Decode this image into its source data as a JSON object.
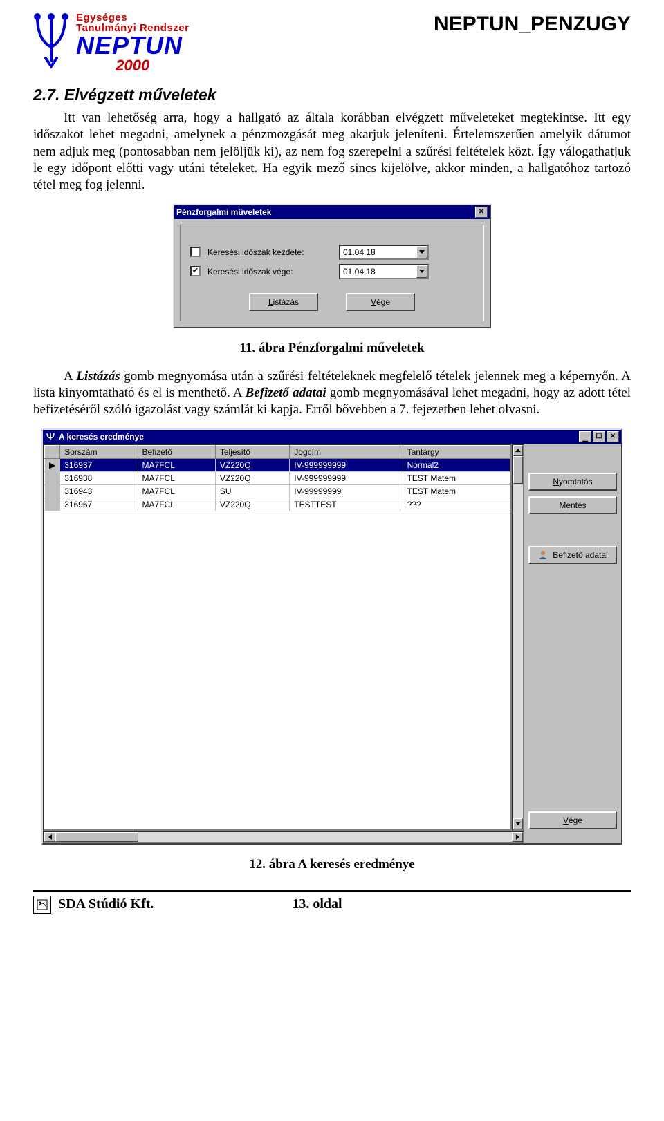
{
  "header": {
    "logo_line1": "Egységes",
    "logo_line2": "Tanulmányi  Rendszer",
    "logo_brand": "NEPTUN",
    "logo_year": "2000",
    "page_title": "NEPTUN_PENZUGY"
  },
  "section": {
    "heading": "2.7. Elvégzett műveletek",
    "para1": "Itt van lehetőség arra, hogy a hallgató az általa korábban elvégzett műveleteket megtekintse. Itt egy időszakot lehet megadni, amelynek a pénzmozgását meg akarjuk jeleníteni. Értelemszerűen amelyik dátumot nem adjuk meg (pontosabban nem jelöljük ki), az nem fog szerepelni a szűrési feltételek közt. Így válogathatjuk le egy időpont előtti vagy utáni tételeket. Ha egyik mező sincs kijelölve, akkor minden, a hallgatóhoz tartozó tétel meg fog jelenni.",
    "caption1": "11. ábra Pénzforgalmi műveletek",
    "para2_pre": "A ",
    "para2_bold1": "Listázás",
    "para2_mid1": " gomb megnyomása után a szűrési feltételeknek megfelelő tételek jelennek meg a képernyőn. A lista kinyomtatható és el is menthető. A ",
    "para2_bold2": "Befizető adatai",
    "para2_mid2": " gomb megnyomásával lehet megadni, hogy az adott tétel befizetéséről szóló igazolást vagy számlát ki kapja. Erről bővebben a 7. fejezetben lehet olvasni.",
    "caption2": "12. ábra A keresés eredménye"
  },
  "dialog1": {
    "title": "Pénzforgalmi műveletek",
    "row1_label": "Keresési időszak kezdete:",
    "row1_checked": false,
    "row1_value": "01.04.18",
    "row2_label": "Keresési időszak vége:",
    "row2_checked": true,
    "row2_value": "01.04.18",
    "btn_list": "Listázás",
    "btn_list_ul": "L",
    "btn_end": "Vége",
    "btn_end_ul": "V"
  },
  "dialog2": {
    "title": "A keresés eredménye",
    "columns": [
      "Sorszám",
      "Befizető",
      "Teljesítő",
      "Jogcím",
      "Tantárgy"
    ],
    "rows": [
      {
        "mark": "▶",
        "sel": true,
        "c": [
          "316937",
          "MA7FCL",
          "VZ220Q",
          "IV-999999999",
          "Normal2"
        ]
      },
      {
        "mark": "",
        "sel": false,
        "c": [
          "316938",
          "MA7FCL",
          "VZ220Q",
          "IV-999999999",
          "TEST Matem"
        ]
      },
      {
        "mark": "",
        "sel": false,
        "c": [
          "316943",
          "MA7FCL",
          "SU",
          "IV-99999999",
          "TEST Matem"
        ]
      },
      {
        "mark": "",
        "sel": false,
        "c": [
          "316967",
          "MA7FCL",
          "VZ220Q",
          "TESTTEST",
          "???"
        ]
      }
    ],
    "btn_print": "Nyomtatás",
    "btn_print_ul": "N",
    "btn_save": "Mentés",
    "btn_save_ul": "M",
    "btn_payer": "Befizető adatai",
    "btn_end": "Vége",
    "btn_end_ul": "V"
  },
  "footer": {
    "company": "SDA Stúdió Kft.",
    "page": "13. oldal"
  }
}
